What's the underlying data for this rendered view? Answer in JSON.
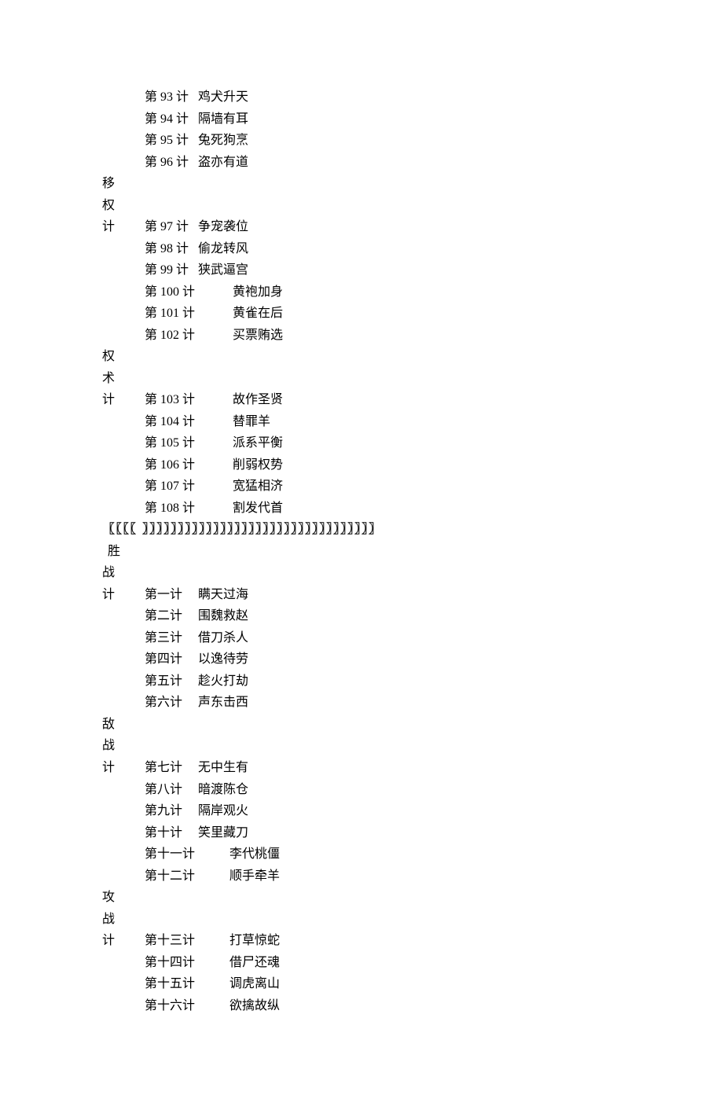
{
  "sections": [
    {
      "category": null,
      "items": [
        {
          "num": "第 93 计",
          "numClass": "num-2col",
          "title": "鸡犬升天"
        },
        {
          "num": "第 94 计",
          "numClass": "num-2col",
          "title": "隔墙有耳"
        },
        {
          "num": "第 95 计",
          "numClass": "num-2col",
          "title": "兔死狗烹"
        },
        {
          "num": "第 96 计",
          "numClass": "num-2col",
          "title": "盗亦有道"
        }
      ]
    },
    {
      "category": [
        "移",
        "权",
        "计"
      ],
      "items": [
        {
          "num": "第 97 计",
          "numClass": "num-2col",
          "title": "争宠袭位"
        },
        {
          "num": "第 98 计",
          "numClass": "num-2col",
          "title": "偷龙转风"
        },
        {
          "num": "第 99 计",
          "numClass": "num-2col",
          "title": "狭武逼宫"
        },
        {
          "num": "第 100 计",
          "numClass": "num-3col",
          "title": "黄袍加身"
        },
        {
          "num": "第 101 计",
          "numClass": "num-3col",
          "title": "黄雀在后"
        },
        {
          "num": "第 102 计",
          "numClass": "num-3col",
          "title": "买票贿选"
        }
      ]
    },
    {
      "category": [
        "权",
        "术",
        "计"
      ],
      "items": [
        {
          "num": "第 103 计",
          "numClass": "num-3col",
          "title": "故作圣贤"
        },
        {
          "num": "第 104 计",
          "numClass": "num-3col",
          "title": "替罪羊"
        },
        {
          "num": "第 105 计",
          "numClass": "num-3col",
          "title": "派系平衡"
        },
        {
          "num": "第 106 计",
          "numClass": "num-3col",
          "title": "削弱权势"
        },
        {
          "num": "第 107 计",
          "numClass": "num-3col",
          "title": "宽猛相济"
        },
        {
          "num": "第 108 计",
          "numClass": "num-3col",
          "title": "割发代首"
        }
      ]
    }
  ],
  "divider": "〖〖〖〖 〗〗〗〗〗〗〗〗〗〗〗〗〗〗〗〗〗〗〗〗〗〗〗〗〗〗〗〗〗〗〗〗〗",
  "sections2_firstCatIndent": true,
  "sections2": [
    {
      "category": [
        "胜",
        "战",
        "计"
      ],
      "items": [
        {
          "num": "第一计",
          "numClass": "num-2col",
          "title": "瞒天过海"
        },
        {
          "num": "第二计",
          "numClass": "num-2col",
          "title": "围魏救赵"
        },
        {
          "num": "第三计",
          "numClass": "num-2col",
          "title": "借刀杀人"
        },
        {
          "num": "第四计",
          "numClass": "num-2col",
          "title": "以逸待劳"
        },
        {
          "num": "第五计",
          "numClass": "num-2col",
          "title": "趁火打劫"
        },
        {
          "num": "第六计",
          "numClass": "num-2col",
          "title": "声东击西"
        }
      ]
    },
    {
      "category": [
        "敌",
        "战",
        "计"
      ],
      "items": [
        {
          "num": "第七计",
          "numClass": "num-2col",
          "title": "无中生有"
        },
        {
          "num": "第八计",
          "numClass": "num-2col",
          "title": "暗渡陈仓"
        },
        {
          "num": "第九计",
          "numClass": "num-2col",
          "title": "隔岸观火"
        },
        {
          "num": "第十计",
          "numClass": "num-2col",
          "title": "笑里藏刀"
        },
        {
          "num": "第十一计",
          "numClass": "num-hanzi",
          "title": "李代桃僵"
        },
        {
          "num": "第十二计",
          "numClass": "num-hanzi",
          "title": "顺手牵羊"
        }
      ]
    },
    {
      "category": [
        "攻",
        "战",
        "计"
      ],
      "items": [
        {
          "num": "第十三计",
          "numClass": "num-hanzi",
          "title": "打草惊蛇"
        },
        {
          "num": "第十四计",
          "numClass": "num-hanzi",
          "title": "借尸还魂"
        },
        {
          "num": "第十五计",
          "numClass": "num-hanzi",
          "title": "调虎离山"
        },
        {
          "num": "第十六计",
          "numClass": "num-hanzi",
          "title": "欲擒故纵"
        }
      ]
    }
  ]
}
